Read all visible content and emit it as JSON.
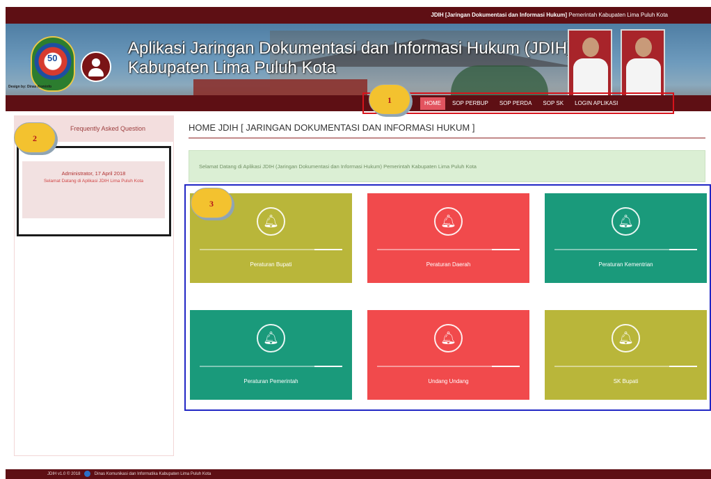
{
  "topbar": {
    "bold_text": "JDIH [Jaringan Dokumentasi dan Informasi Hukum]",
    "rest_text": "Pemerintah Kabupaten Lima Puluh Kota"
  },
  "header": {
    "title_line1": "Aplikasi Jaringan Dokumentasi dan Informasi Hukum (JDIH)",
    "title_line2": "Kabupaten Lima Puluh Kota",
    "emblem_text": "50",
    "design_by": "Design by: Dinas Kominfo"
  },
  "nav": {
    "items": [
      {
        "label": "HOME",
        "active": true
      },
      {
        "label": "SOP PERBUP"
      },
      {
        "label": "SOP PERDA"
      },
      {
        "label": "SOP SK"
      },
      {
        "label": "LOGIN APLIKASI"
      }
    ]
  },
  "callouts": [
    "1",
    "2",
    "3"
  ],
  "sidebar": {
    "heading": "Frequently Asked Question",
    "item_heading": "Administrator, 17 April 2018",
    "item_body": "Selamat Datang di Aplikasi JDIH Lima Puluh Kota"
  },
  "main": {
    "title": "HOME JDIH [ JARINGAN DOKUMENTASI DAN INFORMASI HUKUM ]",
    "welcome": "Selamat Datang di Aplikasi JDIH (Jaringan Dokumentasi dan Informasi Hukum) Pemerintah Kabupaten Lima Puluh Kota"
  },
  "tiles": [
    {
      "label": "Peraturan Bupati",
      "color": "#b9b63a",
      "icon": "bell-icon"
    },
    {
      "label": "Peraturan Daerah",
      "color": "#f14a4c",
      "icon": "bell-icon"
    },
    {
      "label": "Peraturan Kementrian",
      "color": "#1a9a7b",
      "icon": "bell-icon"
    },
    {
      "label": "Peraturan Pemerintah",
      "color": "#1a9a7b",
      "icon": "bell-icon"
    },
    {
      "label": "Undang Undang",
      "color": "#f14a4c",
      "icon": "bell-icon"
    },
    {
      "label": "SK Bupati",
      "color": "#b9b63a",
      "icon": "bell-icon"
    }
  ],
  "footer": {
    "version": "JDIH v1.0 © 2018",
    "org": "Dinas Komunikasi dan Informatika Kabupaten Lima Puluh Kota"
  },
  "colors": {
    "maroon": "#5e0f14",
    "active_tab": "#e2545f",
    "callout": "#f3c22f"
  }
}
